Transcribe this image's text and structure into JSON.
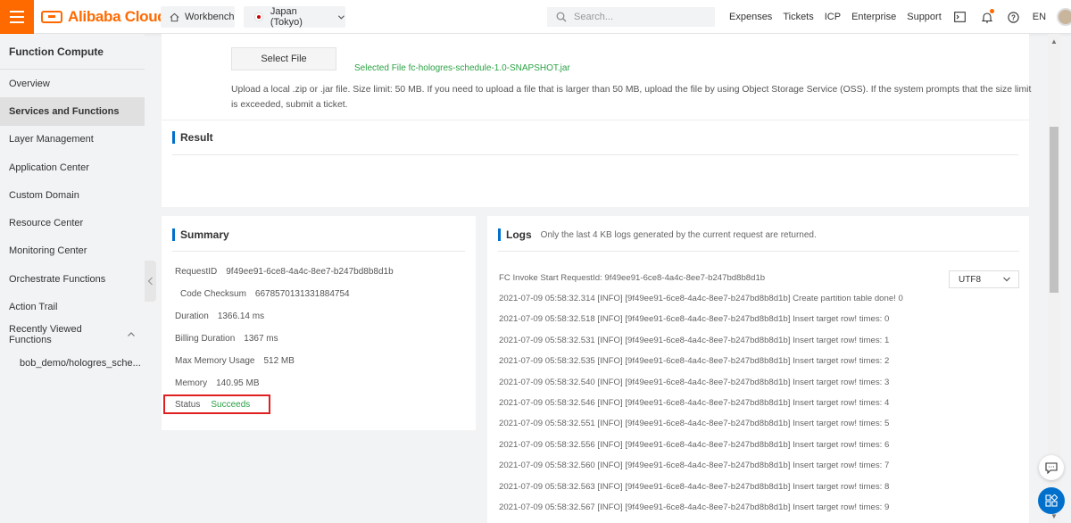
{
  "header": {
    "brand": "Alibaba Cloud",
    "workbench_label": "Workbench",
    "region_label": "Japan (Tokyo)",
    "search_placeholder": "Search...",
    "nav_links": [
      "Expenses",
      "Tickets",
      "ICP",
      "Enterprise",
      "Support"
    ],
    "language": "EN",
    "brand_color": "#ff6a00"
  },
  "sidebar": {
    "title": "Function Compute",
    "items": [
      {
        "label": "Overview"
      },
      {
        "label": "Services and Functions",
        "active": true
      },
      {
        "label": "Layer Management"
      },
      {
        "label": "Application Center"
      },
      {
        "label": "Custom Domain"
      },
      {
        "label": "Resource Center"
      },
      {
        "label": "Monitoring Center"
      },
      {
        "label": "Orchestrate Functions"
      },
      {
        "label": "Action Trail"
      },
      {
        "label": "Recently Viewed Functions"
      },
      {
        "label": "bob_demo/hologres_sche..."
      }
    ]
  },
  "upload": {
    "select_button": "Select File",
    "selected_file": "Selected File fc-hologres-schedule-1.0-SNAPSHOT.jar",
    "hint": "Upload a local .zip or .jar file. Size limit: 50 MB. If you need to upload a file that is larger than 50 MB, upload the file by using Object Storage Service (OSS). If the system prompts that the size limit is exceeded, submit a ticket."
  },
  "result": {
    "title": "Result"
  },
  "summary": {
    "title": "Summary",
    "request_id_label": "RequestID",
    "request_id_value": "9f49ee91-6ce8-4a4c-8ee7-b247bd8b8d1b",
    "checksum_label": "Code Checksum",
    "checksum_value": "6678570131331884754",
    "duration_label": "Duration",
    "duration_value": "1366.14 ms",
    "billing_label": "Billing Duration",
    "billing_value": "1367 ms",
    "max_memory_label": "Max Memory Usage",
    "max_memory_value": "512 MB",
    "memory_label": "Memory",
    "memory_value": "140.95 MB",
    "status_label": "Status",
    "status_value": "Succeeds",
    "status_color": "#2ba245",
    "highlight_color": "#e02020"
  },
  "logs": {
    "title": "Logs",
    "subtitle": "Only the last 4 KB logs generated by the current request are returned.",
    "encoding": "UTF8",
    "lines": [
      "FC Invoke Start RequestId: 9f49ee91-6ce8-4a4c-8ee7-b247bd8b8d1b",
      "2021-07-09 05:58:32.314 [INFO] [9f49ee91-6ce8-4a4c-8ee7-b247bd8b8d1b] Create partition table done! 0",
      "2021-07-09 05:58:32.518 [INFO] [9f49ee91-6ce8-4a4c-8ee7-b247bd8b8d1b] Insert target row! times: 0",
      "2021-07-09 05:58:32.531 [INFO] [9f49ee91-6ce8-4a4c-8ee7-b247bd8b8d1b] Insert target row! times: 1",
      "2021-07-09 05:58:32.535 [INFO] [9f49ee91-6ce8-4a4c-8ee7-b247bd8b8d1b] Insert target row! times: 2",
      "2021-07-09 05:58:32.540 [INFO] [9f49ee91-6ce8-4a4c-8ee7-b247bd8b8d1b] Insert target row! times: 3",
      "2021-07-09 05:58:32.546 [INFO] [9f49ee91-6ce8-4a4c-8ee7-b247bd8b8d1b] Insert target row! times: 4",
      "2021-07-09 05:58:32.551 [INFO] [9f49ee91-6ce8-4a4c-8ee7-b247bd8b8d1b] Insert target row! times: 5",
      "2021-07-09 05:58:32.556 [INFO] [9f49ee91-6ce8-4a4c-8ee7-b247bd8b8d1b] Insert target row! times: 6",
      "2021-07-09 05:58:32.560 [INFO] [9f49ee91-6ce8-4a4c-8ee7-b247bd8b8d1b] Insert target row! times: 7",
      "2021-07-09 05:58:32.563 [INFO] [9f49ee91-6ce8-4a4c-8ee7-b247bd8b8d1b] Insert target row! times: 8",
      "2021-07-09 05:58:32.567 [INFO] [9f49ee91-6ce8-4a4c-8ee7-b247bd8b8d1b] Insert target row! times: 9"
    ]
  },
  "icons": {
    "menu": "hamburger-menu-icon",
    "workbench": "home-icon",
    "search": "search-icon",
    "terminal": "terminal-icon",
    "notifications": "bell-icon",
    "help": "help-icon",
    "feedback": "feedback-icon",
    "apps": "apps-icon"
  }
}
